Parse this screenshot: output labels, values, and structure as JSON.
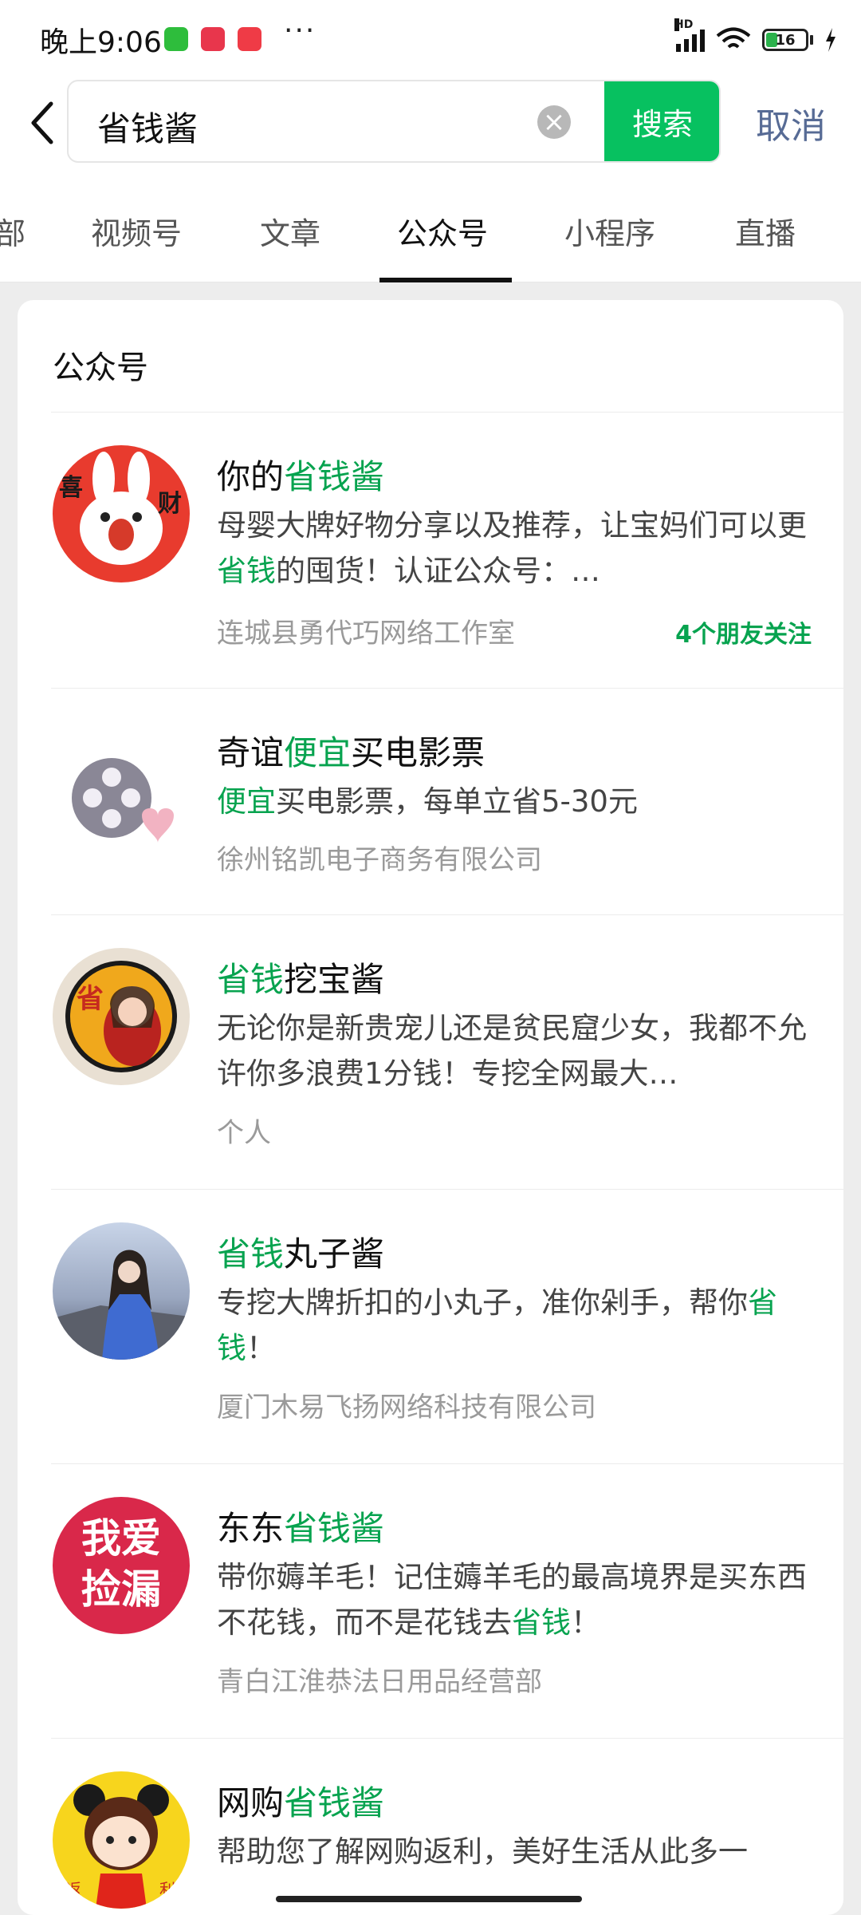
{
  "status_bar": {
    "time": "晚上9:06",
    "more": "···",
    "network_label": "HD",
    "battery": "16",
    "app_colors": [
      "#2ebd3c",
      "#e8364c",
      "#ef3b46"
    ]
  },
  "header": {
    "back_icon": "chevron-left-icon",
    "search_value": "省钱酱",
    "clear_icon": "clear-icon",
    "search_button": "搜索",
    "cancel": "取消"
  },
  "tabs": [
    "部",
    "视频号",
    "文章",
    "公众号",
    "小程序",
    "直播"
  ],
  "active_tab": "公众号",
  "section_title": "公众号",
  "results": [
    {
      "title_pre": "你的",
      "title_hl": "省钱酱",
      "title_post": "",
      "desc_a": "母婴大牌好物分享以及推荐，让宝妈们可以更",
      "desc_hl": "省钱",
      "desc_b": "的囤货！认证公众号：…",
      "sub": "连城县勇代巧网络工作室",
      "badge": "4个朋友关注",
      "avatar_icon": "rabbit-avatar",
      "avatar_text_a": "喜",
      "avatar_text_b": "财"
    },
    {
      "title_pre": "奇谊",
      "title_hl": "便宜",
      "title_post": "买电影票",
      "desc_hl": "便宜",
      "desc_b": "买电影票，每单立省5-30元",
      "sub": "徐州铭凯电子商务有限公司",
      "avatar_icon": "film-reel-icon"
    },
    {
      "title_hl": "省钱",
      "title_post": "挖宝酱",
      "desc": "无论你是新贵宠儿还是贫民窟少女，我都不允许你多浪费1分钱！专挖全网最大…",
      "sub": "个人",
      "avatar_icon": "girl-avatar",
      "avatar_text": "省"
    },
    {
      "title_hl": "省钱",
      "title_post": "丸子酱",
      "desc_a": "专挖大牌折扣的小丸子，准你剁手，帮你",
      "desc_hl": "省钱",
      "desc_b": "！",
      "sub": "厦门木易飞扬网络科技有限公司",
      "avatar_icon": "photo-avatar"
    },
    {
      "title_pre": "东东",
      "title_hl": "省钱酱",
      "desc_a": "带你薅羊毛！记住薅羊毛的最高境界是买东西不花钱，而不是花钱去",
      "desc_hl": "省钱",
      "desc_b": "！",
      "sub": "青白江淮恭法日用品经营部",
      "avatar_icon": "logo-avatar",
      "avatar_line1": "我爱",
      "avatar_line2": "捡漏"
    },
    {
      "title_pre": "网购",
      "title_hl": "省钱酱",
      "desc": "帮助您了解网购返利，美好生活从此多一",
      "avatar_icon": "cartoon-avatar",
      "avatar_text_a": "返",
      "avatar_text_b": "利"
    }
  ]
}
